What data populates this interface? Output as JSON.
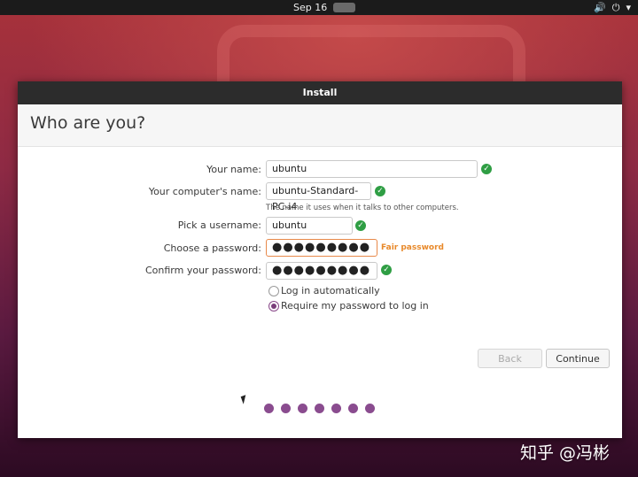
{
  "topbar": {
    "date": "Sep 16",
    "icons": [
      "volume-icon",
      "power-icon",
      "chevron-down-icon"
    ]
  },
  "window": {
    "title": "Install",
    "heading": "Who are you?",
    "form": {
      "name_label": "Your name:",
      "name_value": "ubuntu",
      "computer_label": "Your computer's name:",
      "computer_value": "ubuntu-Standard-PC-i4",
      "computer_hint": "The name it uses when it talks to other computers.",
      "username_label": "Pick a username:",
      "username_value": "ubuntu",
      "password_label": "Choose a password:",
      "password_value": "●●●●●●●●●",
      "password_strength": "Fair password",
      "confirm_label": "Confirm your password:",
      "confirm_value": "●●●●●●●●●",
      "option_auto_login": "Log in automatically",
      "option_require_password": "Require my password to log in",
      "selected_option": "require_password"
    },
    "buttons": {
      "back": "Back",
      "continue": "Continue"
    },
    "progress": {
      "total_steps": 7,
      "current_step": 7
    }
  },
  "colors": {
    "accent": "#8a4c8f",
    "ok": "#2f9e44",
    "warning": "#e8892a",
    "titlebar": "#2c2c2c"
  },
  "watermark": "知乎 @冯彬"
}
